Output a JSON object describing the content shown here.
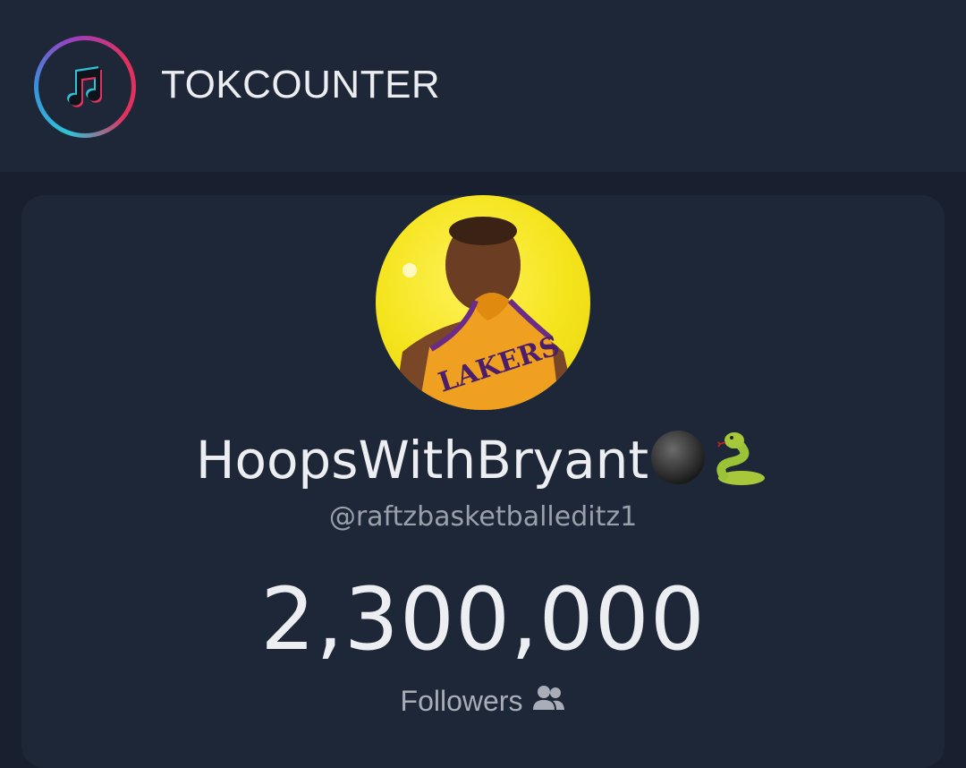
{
  "header": {
    "brand": "TOKCOUNTER"
  },
  "profile": {
    "display_name": "HoopsWithBryant",
    "name_emojis": [
      "black-circle",
      "snake"
    ],
    "handle": "@raftzbasketballeditz1",
    "follower_count": "2,300,000",
    "followers_label": "Followers",
    "avatar_jersey_text": "LAKERS"
  },
  "colors": {
    "background": "#182030",
    "panel": "#1e2737",
    "text": "#eceef2",
    "muted": "#9aa0ab",
    "logo_cyan": "#2ec4d6",
    "logo_pink": "#e0325e",
    "avatar_yellow": "#f4e41c",
    "jersey_gold": "#f0a020"
  }
}
